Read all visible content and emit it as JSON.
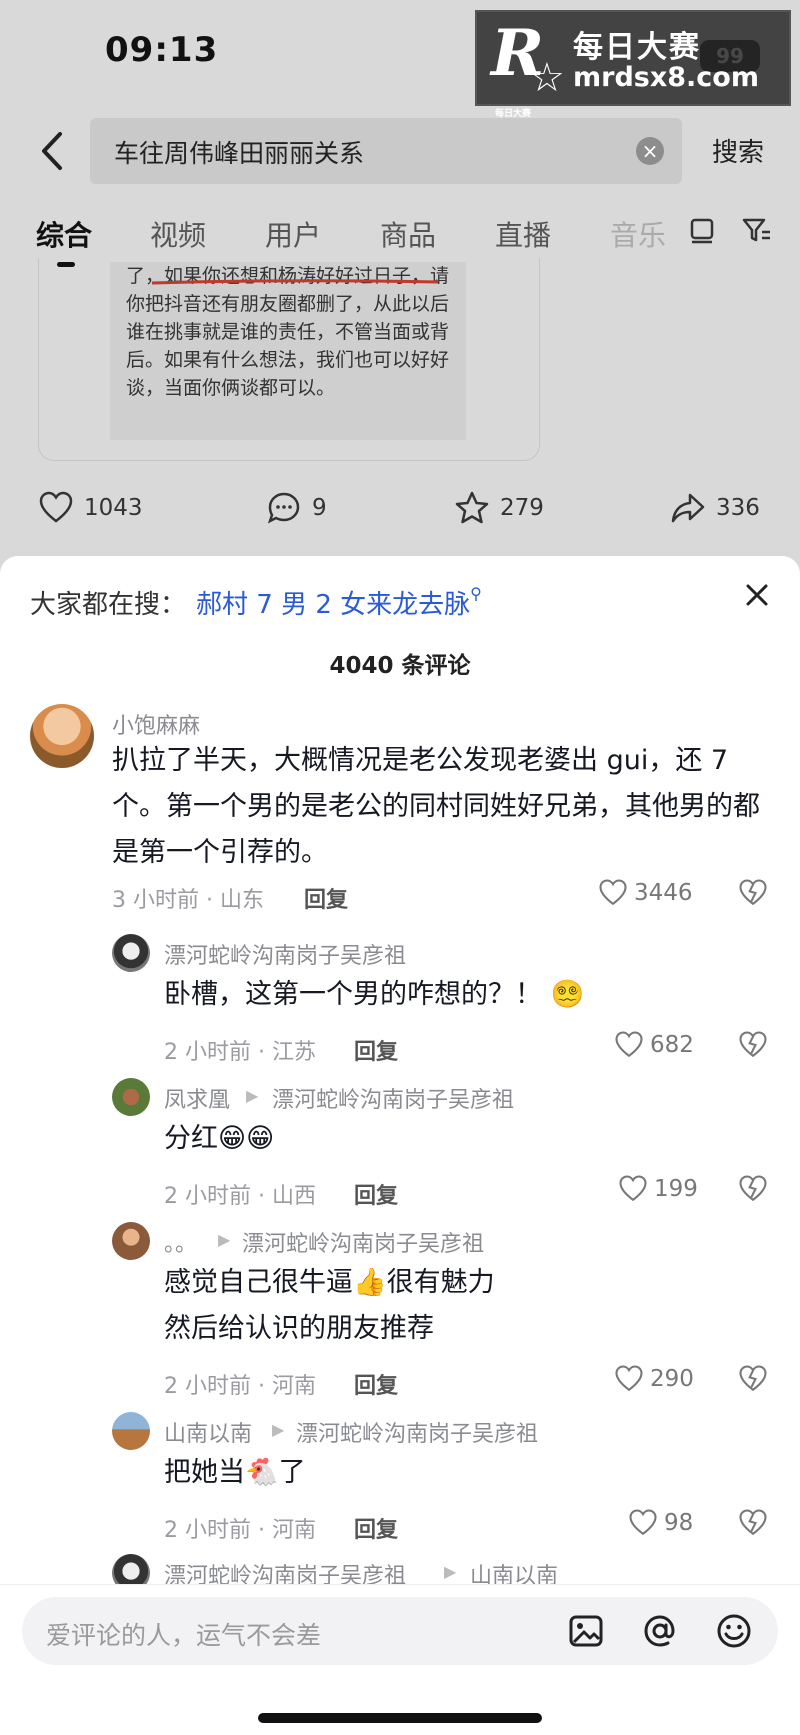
{
  "status_bar": {
    "time": "09:13",
    "battery": "99"
  },
  "watermark": {
    "logo": "R",
    "logo_sub": "每日大赛",
    "title": "每日大赛",
    "url": "mrdsx8.com"
  },
  "search": {
    "query": "车往周伟峰田丽丽关系",
    "clear": "×",
    "button": "搜索"
  },
  "tabs": [
    {
      "label": "综合",
      "active": true
    },
    {
      "label": "视频"
    },
    {
      "label": "用户"
    },
    {
      "label": "商品"
    },
    {
      "label": "直播"
    },
    {
      "label": "音乐"
    }
  ],
  "post": {
    "text": "了，如果你还想和杨涛好好过日子，请你把抖音还有朋友圈都删了，从此以后谁在挑事就是谁的责任，不管当面或背后。如果有什么想法，我们也可以好好谈，当面你俩谈都可以。",
    "likes": "1043",
    "comments": "9",
    "favorites": "279",
    "shares": "336"
  },
  "comments_sheet": {
    "trending_label": "大家都在搜：",
    "trending_link": "郝村 7 男 2 女来龙去脉",
    "count_label": "4040 条评论",
    "reply_label": "回复",
    "comments": [
      {
        "user": "小饱麻麻",
        "text": "扒拉了半天，大概情况是老公发现老婆出 gui，还 7 个。第一个男的是老公的同村同姓好兄弟，其他男的都是第一个引荐的。",
        "meta": "3 小时前 · 山东",
        "likes": "3446"
      },
      {
        "user": "漂河蛇岭沟南岗子吴彦祖",
        "text": "卧槽，这第一个男的咋想的？！ 😵‍💫",
        "meta": "2 小时前 · 江苏",
        "likes": "682"
      },
      {
        "user": "凤求凰",
        "reply_to": "漂河蛇岭沟南岗子吴彦祖",
        "text": "分红😁😁",
        "meta": "2 小时前 · 山西",
        "likes": "199"
      },
      {
        "user": "。。",
        "reply_to": "漂河蛇岭沟南岗子吴彦祖",
        "text": "感觉自己很牛逼👍很有魅力",
        "text2": "然后给认识的朋友推荐",
        "meta": "2 小时前 · 河南",
        "likes": "290"
      },
      {
        "user": "山南以南",
        "reply_to": "漂河蛇岭沟南岗子吴彦祖",
        "text": "把她当🐔了",
        "meta": "2 小时前 · 河南",
        "likes": "98"
      },
      {
        "user": "漂河蛇岭沟南岗子吴彦祖",
        "reply_to": "山南以南"
      }
    ]
  },
  "input": {
    "placeholder": "爱评论的人，运气不会差"
  }
}
